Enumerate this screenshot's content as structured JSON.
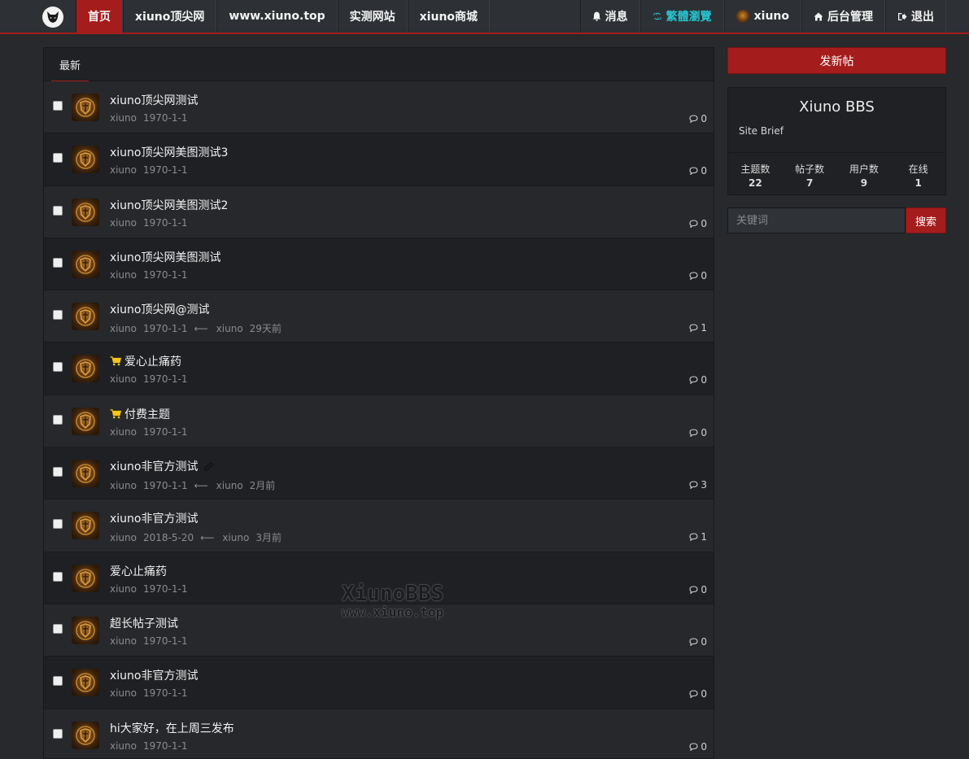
{
  "nav": {
    "left": [
      {
        "label": "首页",
        "active": true
      },
      {
        "label": "xiuno顶尖网"
      },
      {
        "label": "www.xiuno.top"
      },
      {
        "label": "实测网站"
      },
      {
        "label": "xiuno商城"
      }
    ],
    "right": {
      "messages": "消息",
      "convert": "繁體瀏覽",
      "user": "xiuno",
      "admin": "后台管理",
      "logout": "退出"
    }
  },
  "tabs": {
    "latest": "最新"
  },
  "threads": [
    {
      "title": "xiuno顶尖网测试",
      "author": "xiuno",
      "date": "1970-1-1",
      "replies": "0"
    },
    {
      "title": "xiuno顶尖网美图测试3",
      "author": "xiuno",
      "date": "1970-1-1",
      "replies": "0"
    },
    {
      "title": "xiuno顶尖网美图测试2",
      "author": "xiuno",
      "date": "1970-1-1",
      "replies": "0"
    },
    {
      "title": "xiuno顶尖网美图测试",
      "author": "xiuno",
      "date": "1970-1-1",
      "replies": "0"
    },
    {
      "title": "xiuno顶尖网@测试",
      "author": "xiuno",
      "date": "1970-1-1",
      "last_user": "xiuno",
      "last_time": "29天前",
      "replies": "1"
    },
    {
      "title": "爱心止痛药",
      "author": "xiuno",
      "date": "1970-1-1",
      "replies": "0",
      "paid": true
    },
    {
      "title": "付费主题",
      "author": "xiuno",
      "date": "1970-1-1",
      "replies": "0",
      "paid": true
    },
    {
      "title": "xiuno非官方测试",
      "author": "xiuno",
      "date": "1970-1-1",
      "last_user": "xiuno",
      "last_time": "2月前",
      "replies": "3",
      "attach": true
    },
    {
      "title": "xiuno非官方测试",
      "author": "xiuno",
      "date": "2018-5-20",
      "last_user": "xiuno",
      "last_time": "3月前",
      "replies": "1"
    },
    {
      "title": "爱心止痛药",
      "author": "xiuno",
      "date": "1970-1-1",
      "replies": "0"
    },
    {
      "title": "超长帖子测试",
      "author": "xiuno",
      "date": "1970-1-1",
      "replies": "0"
    },
    {
      "title": "xiuno非官方测试",
      "author": "xiuno",
      "date": "1970-1-1",
      "replies": "0"
    },
    {
      "title": "hi大家好，在上周三发布",
      "author": "xiuno",
      "date": "1970-1-1",
      "replies": "0"
    }
  ],
  "watermark": {
    "line1": "XiunoBBS",
    "line2": "www.xiuno.top"
  },
  "sidebar": {
    "new_post": "发新帖",
    "site_name": "Xiuno BBS",
    "site_brief": "Site Brief",
    "stats": [
      {
        "label": "主题数",
        "value": "22"
      },
      {
        "label": "帖子数",
        "value": "7"
      },
      {
        "label": "用户数",
        "value": "9"
      },
      {
        "label": "在线",
        "value": "1"
      }
    ],
    "search_placeholder": "关键词",
    "search_button": "搜索"
  },
  "colors": {
    "accent": "#a51c1c",
    "cyan": "#27c3cf",
    "paid_icon": "#f5c518"
  }
}
